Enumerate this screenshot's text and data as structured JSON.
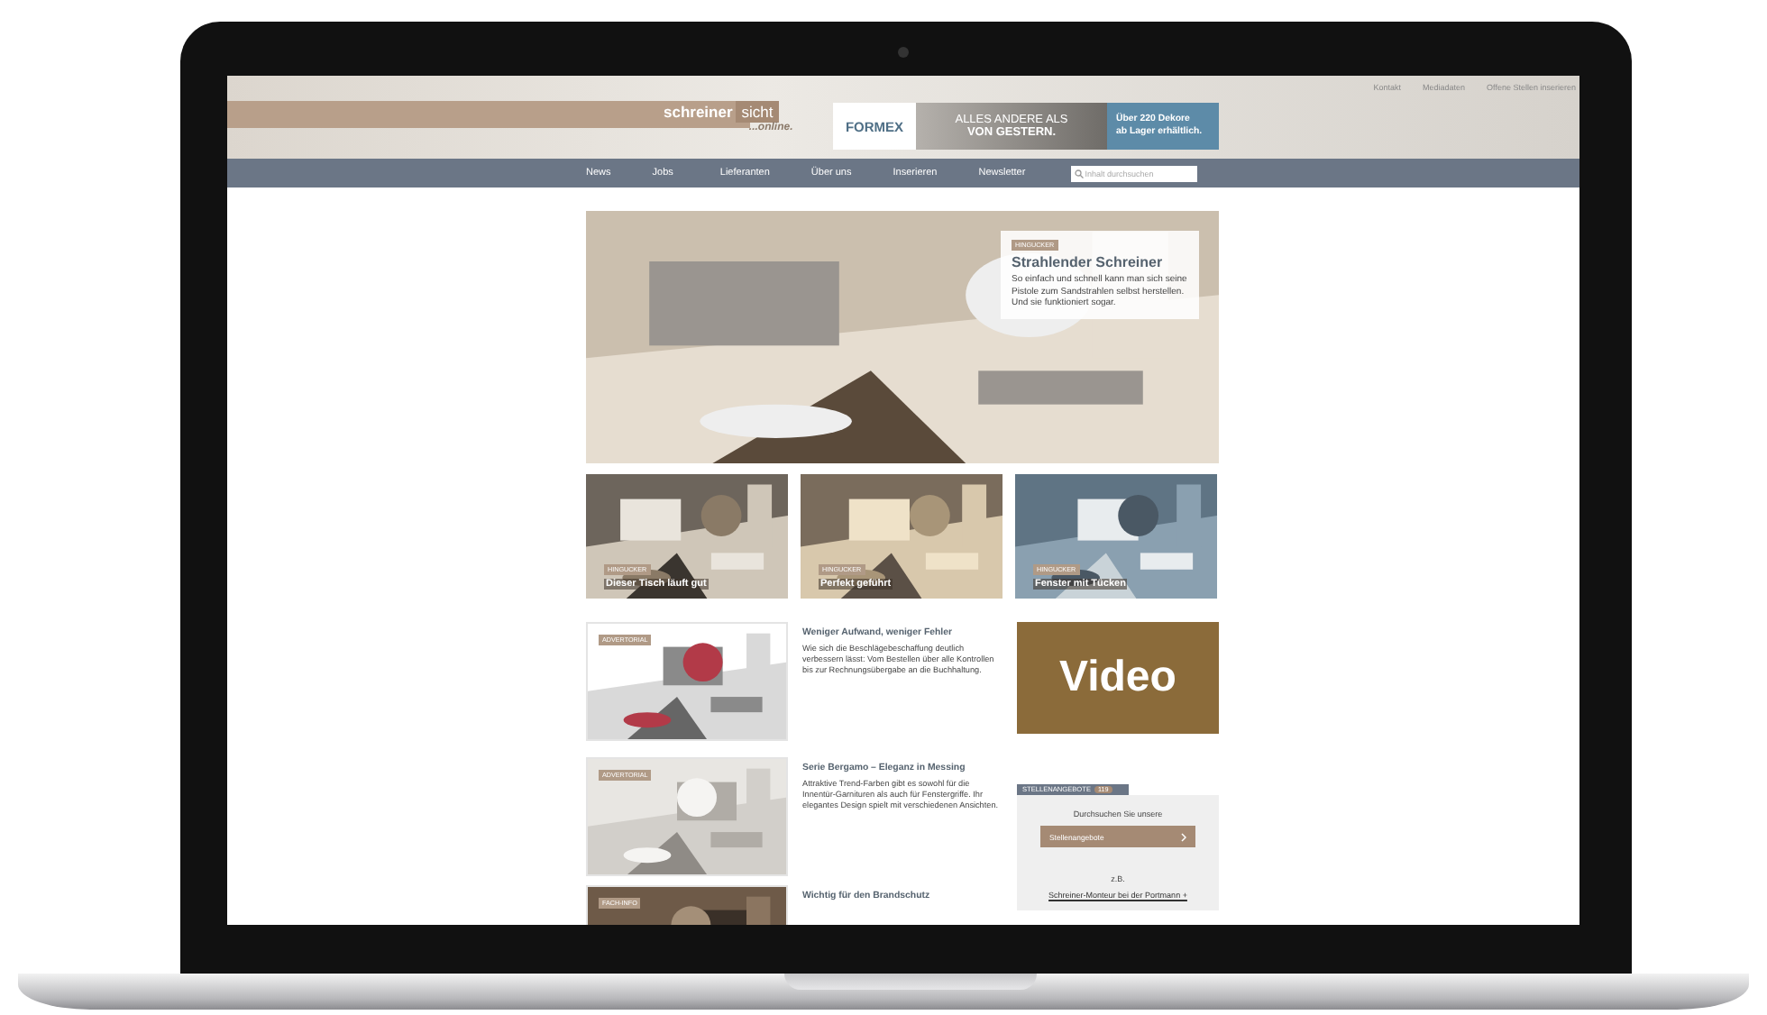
{
  "header": {
    "top_links": [
      "Kontakt",
      "Mediadaten",
      "Offene Stellen inserieren"
    ],
    "logo": {
      "word_1": "schreiner",
      "word_2": "sicht",
      "tagline": "...online."
    },
    "ad": {
      "brand": "FORMEX",
      "headline_1": "ALLES ANDERE ALS",
      "headline_2": "VON GESTERN.",
      "side_1": "Über 220 Dekore",
      "side_2": "ab Lager erhältlich."
    }
  },
  "nav": {
    "items": [
      "News",
      "Jobs",
      "Lieferanten",
      "Über uns",
      "Inserieren",
      "Newsletter"
    ],
    "search": {
      "placeholder": "Inhalt durchsuchen"
    }
  },
  "hero": {
    "tag": "HINGUCKER",
    "title": "Strahlender Schreiner",
    "text": "So einfach und schnell kann man sich seine Pistole zum Sandstrahlen selbst herstellen. Und sie funktioniert sogar."
  },
  "teasers": [
    {
      "tag": "HINGUCKER",
      "title": "Dieser Tisch läuft gut"
    },
    {
      "tag": "HINGUCKER",
      "title": "Perfekt geführt"
    },
    {
      "tag": "HINGUCKER",
      "title": "Fenster mit Tücken"
    }
  ],
  "articles": [
    {
      "tag": "ADVERTORIAL",
      "title": "Weniger Aufwand, weniger Fehler",
      "text": "Wie sich die Beschlägebeschaffung deutlich verbessern lässt: Vom Bestellen über alle Kontrollen bis zur Rechnungsübergabe an die Buchhaltung."
    },
    {
      "tag": "ADVERTORIAL",
      "title": "Serie Bergamo – Eleganz in Messing",
      "text": "Attraktive Trend-Farben gibt es sowohl für die Innentür-Garnituren als auch für Fenstergriffe. Ihr elegantes Design spielt mit verschiedenen Ansichten."
    },
    {
      "tag": "FACH-INFO",
      "title": "Wichtig für den Brandschutz"
    }
  ],
  "video": {
    "label": "Video"
  },
  "jobs": {
    "title": "STELLENANGEBOTE",
    "count": "119",
    "intro": "Durchsuchen Sie unsere",
    "button": "Stellenangebote",
    "example_label": "z.B.",
    "example_link": "Schreiner-Monteur bei der Portmann +"
  }
}
